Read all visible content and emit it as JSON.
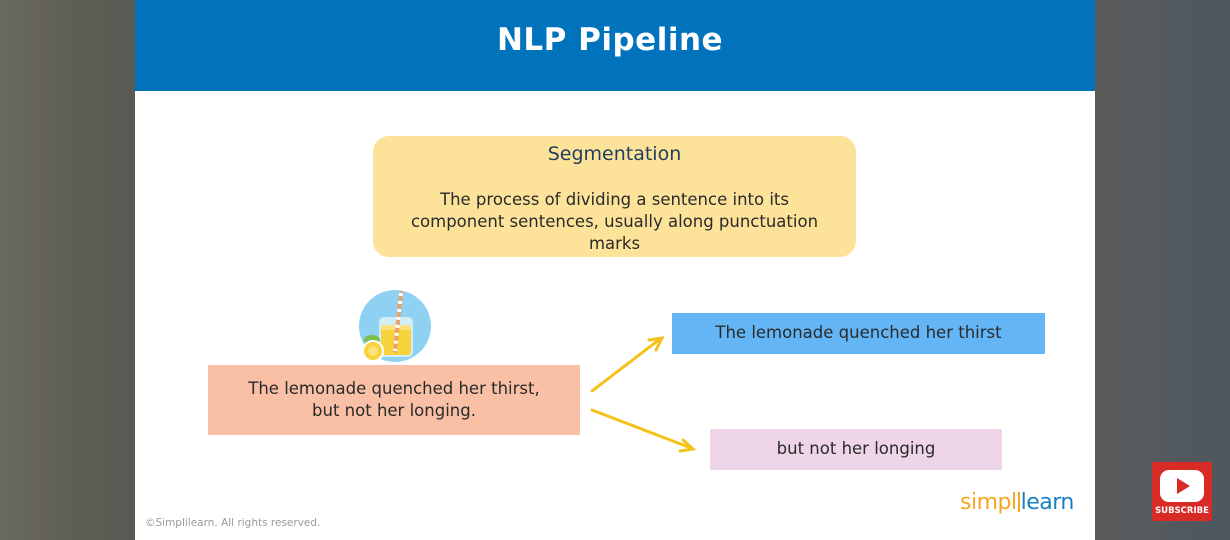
{
  "slide": {
    "title": "NLP Pipeline",
    "definition": {
      "title": "Segmentation",
      "text": "The process of dividing a sentence into its component sentences, usually along punctuation marks"
    },
    "example": {
      "source_line1": "The lemonade quenched her thirst,",
      "source_line2": "but not her longing.",
      "output_1": "The lemonade quenched her thirst",
      "output_2": "but not her longing"
    },
    "logo": {
      "part1": "simpl",
      "part2": "learn"
    },
    "copyright": "©Simplilearn. All rights reserved."
  },
  "subscribe_button": {
    "label": "SUBSCRIBE"
  },
  "colors": {
    "header": "#0173bc",
    "definition_box": "#fde29a",
    "source_box": "#f9c0a6",
    "output_box_1": "#63b5f6",
    "output_box_2": "#eed5e8",
    "arrow": "#f4c21b",
    "subscribe": "#d82b26"
  },
  "icons": {
    "illustration": "lemonade-jar-icon",
    "subscribe": "youtube-play-icon"
  }
}
